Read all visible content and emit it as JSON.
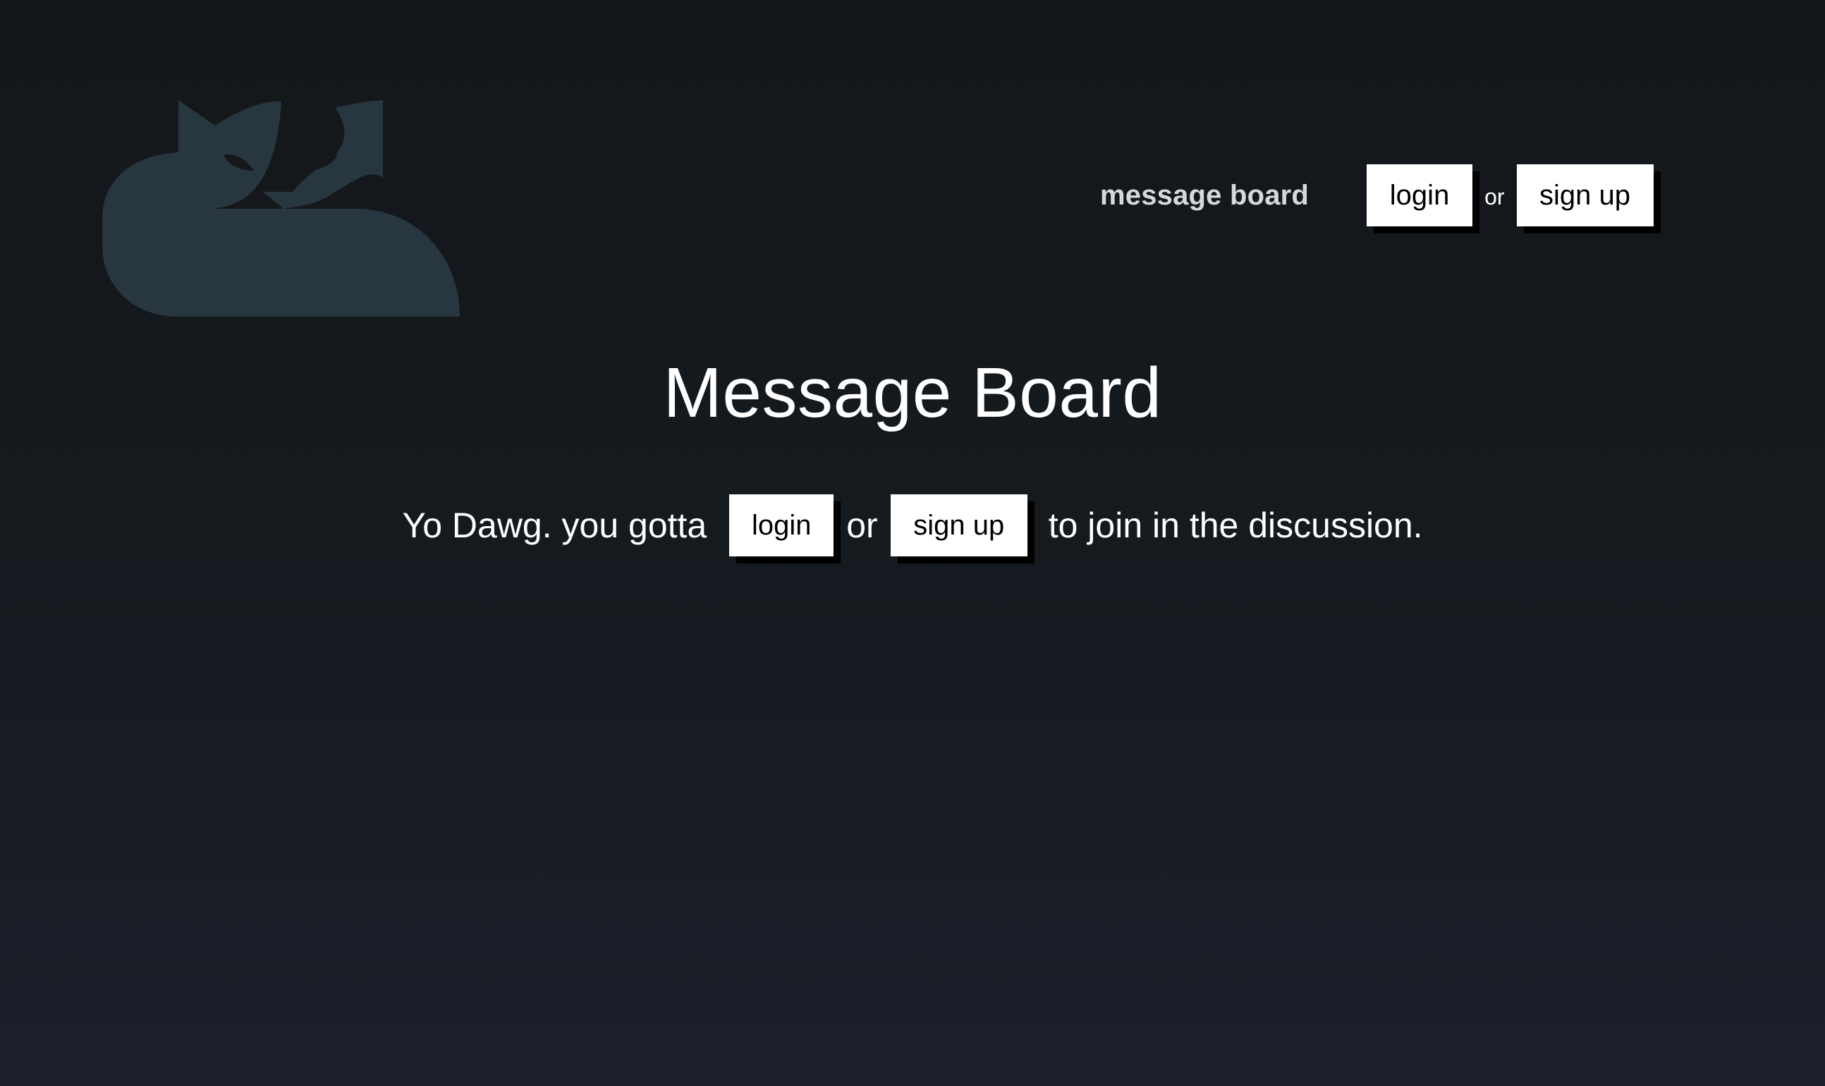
{
  "brand": {
    "logo_icon": "fox-cat-logo-icon",
    "logo_color": "#283640"
  },
  "nav": {
    "message_board_link": "message board",
    "login_label": "login",
    "or_text": "or",
    "signup_label": "sign up"
  },
  "main": {
    "title": "Message Board",
    "prompt_before": "Yo Dawg. you gotta",
    "login_label": "login",
    "or_text": "or",
    "signup_label": "sign up",
    "prompt_after": "to join in the discussion."
  },
  "colors": {
    "button_bg": "#ffffff",
    "button_shadow": "#000000",
    "text": "#ffffff"
  }
}
